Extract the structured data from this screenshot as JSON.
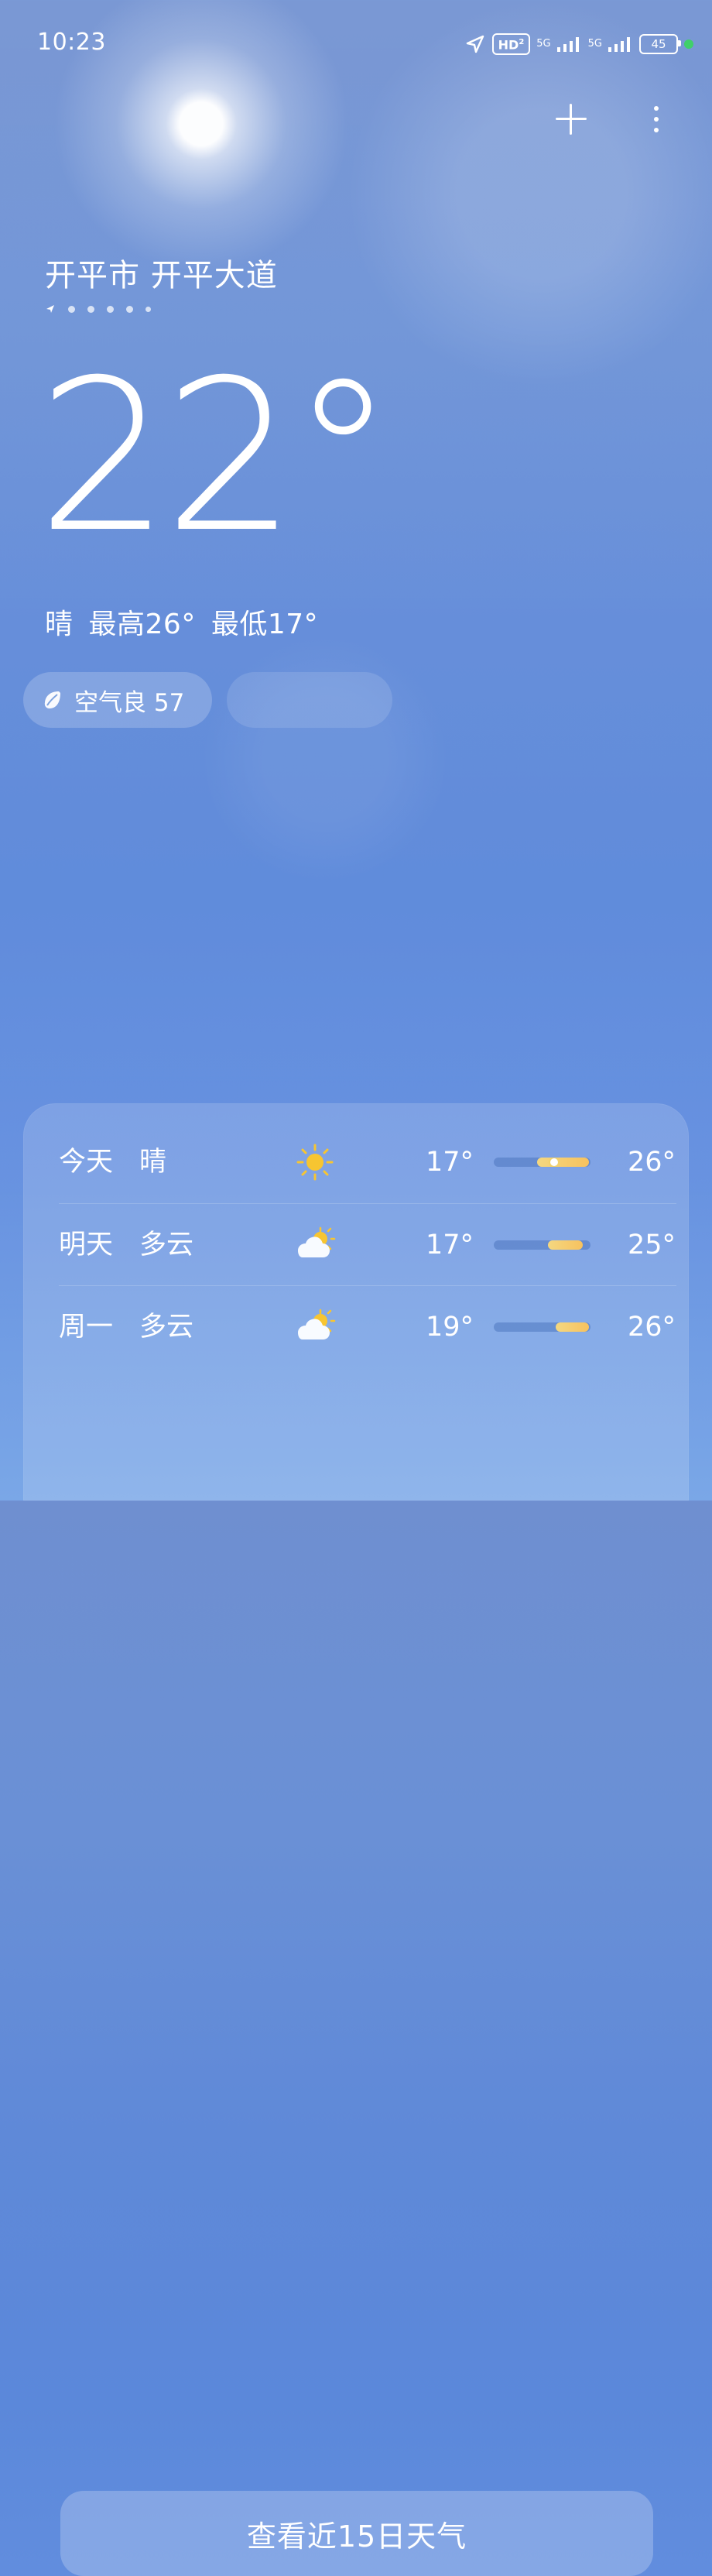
{
  "status_bar": {
    "time": "10:23",
    "hd_badge": "HD",
    "hd_subscript": "2",
    "network_1": "5G",
    "network_2": "5G",
    "battery": "45",
    "status_dot_color": "#40d06a"
  },
  "header": {
    "location": "开平市 开平大道",
    "page_indicator_dots": 5
  },
  "current": {
    "temperature": "22°",
    "condition": "晴",
    "high": "最高26°",
    "low": "最低17°"
  },
  "chips": {
    "aqi": "空气良 57",
    "blurred_chip_visible": true
  },
  "forecast": {
    "rows": [
      {
        "day": "今天",
        "condition": "晴",
        "icon": "sun-icon",
        "low": "17°",
        "high": "26°",
        "bar_start": 0.45,
        "bar_end": 0.98,
        "current_marker": 0.62
      },
      {
        "day": "明天",
        "condition": "多云",
        "icon": "partly-cloudy-icon",
        "low": "17°",
        "high": "25°",
        "bar_start": 0.56,
        "bar_end": 0.92
      },
      {
        "day": "周一",
        "condition": "多云",
        "icon": "partly-cloudy-icon",
        "low": "19°",
        "high": "26°",
        "bar_start": 0.64,
        "bar_end": 0.98
      }
    ],
    "button_label": "查看近15日天气"
  },
  "colors": {
    "sky_top": "#6f8fd0",
    "sky_bottom": "#7aa7e7",
    "bar_fill": "#f7c25f"
  }
}
